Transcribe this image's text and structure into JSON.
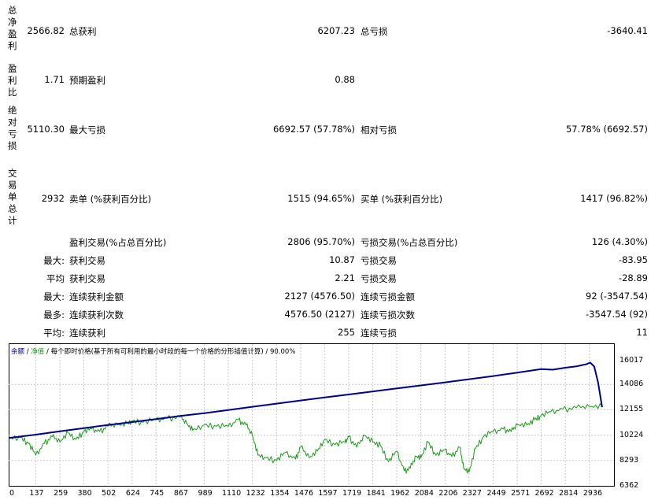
{
  "report": {
    "row1": {
      "vlabel": "总净盈利",
      "v1": "2566.82",
      "l2": "总获利",
      "v2": "6207.23",
      "l3": "总亏损",
      "v3": "-3640.41"
    },
    "row2": {
      "vlabel": "盈利比",
      "v1": "1.71",
      "l2": "预期盈利",
      "v2": "0.88"
    },
    "row3": {
      "vlabel": "绝对亏损",
      "v1": "5110.30",
      "l2": "最大亏损",
      "v2": "6692.57 (57.78%)",
      "l3": "相对亏损",
      "v3": "57.78% (6692.57)"
    },
    "row4": {
      "vlabel": "交易单总计",
      "v1": "2932",
      "l2": "卖单 (%获利百分比)",
      "v2": "1515 (94.65%)",
      "l3": "买单 (%获利百分比)",
      "v3": "1417 (96.82%)"
    },
    "stats": [
      {
        "prefix": "",
        "l2": "盈利交易(%占总百分比)",
        "v2": "2806 (95.70%)",
        "l3": "亏损交易(%占总百分比)",
        "v3": "126 (4.30%)"
      },
      {
        "prefix": "最大:",
        "l2": "获利交易",
        "v2": "10.87",
        "l3": "亏损交易",
        "v3": "-83.95"
      },
      {
        "prefix": "平均",
        "l2": "获利交易",
        "v2": "2.21",
        "l3": "亏损交易",
        "v3": "-28.89"
      },
      {
        "prefix": "最大:",
        "l2": "连续获利金额",
        "v2": "2127 (4576.50)",
        "l3": "连续亏损金额",
        "v3": "92 (-3547.54)"
      },
      {
        "prefix": "最多:",
        "l2": "连续获利次数",
        "v2": "4576.50 (2127)",
        "l3": "连续亏损次数",
        "v3": "-3547.54 (92)"
      },
      {
        "prefix": "平均:",
        "l2": "连续获利",
        "v2": "255",
        "l3": "连续亏损",
        "v3": "11"
      }
    ]
  },
  "chart_legend": {
    "balance": "余额",
    "sep1": " / ",
    "equity": "净值",
    "rest": " / 每个即时价格(基于所有可利用的最小时段的每一个价格的分形插值计算) / 90.00%"
  },
  "colors": {
    "balance": "#00008b",
    "equity": "#1a9a1a",
    "grid": "#c8c8c8"
  },
  "chart_data": {
    "type": "line",
    "title": "",
    "xlabel": "",
    "ylabel": "",
    "x_ticks": [
      "0",
      "137",
      "259",
      "380",
      "502",
      "624",
      "745",
      "867",
      "989",
      "1110",
      "1232",
      "1354",
      "1476",
      "1597",
      "1719",
      "1841",
      "1962",
      "2084",
      "2206",
      "2327",
      "2449",
      "2571",
      "2692",
      "2814",
      "2936"
    ],
    "y_ticks": [
      "16017",
      "14086",
      "12155",
      "10224",
      "8293",
      "6362"
    ],
    "ylim": [
      6362,
      16017
    ],
    "xlim": [
      0,
      3060
    ],
    "grid": true,
    "series": [
      {
        "name": "余额",
        "x": [
          0,
          137,
          259,
          380,
          502,
          624,
          745,
          867,
          989,
          1110,
          1232,
          1354,
          1476,
          1597,
          1719,
          1841,
          1962,
          2084,
          2206,
          2327,
          2449,
          2571,
          2692,
          2750,
          2814,
          2870,
          2900,
          2920,
          2940,
          2960,
          2980,
          3000
        ],
        "values": [
          10000,
          10260,
          10520,
          10760,
          11000,
          11220,
          11450,
          11680,
          11900,
          12130,
          12380,
          12620,
          12860,
          13090,
          13320,
          13550,
          13780,
          14010,
          14240,
          14480,
          14720,
          14980,
          15250,
          15210,
          15360,
          15460,
          15560,
          15620,
          15750,
          15450,
          14200,
          12350
        ]
      },
      {
        "name": "净值",
        "x": [
          0,
          60,
          100,
          137,
          180,
          220,
          259,
          300,
          340,
          380,
          420,
          460,
          502,
          550,
          600,
          624,
          680,
          745,
          800,
          867,
          900,
          930,
          989,
          1050,
          1110,
          1160,
          1200,
          1232,
          1260,
          1300,
          1354,
          1400,
          1450,
          1476,
          1520,
          1560,
          1597,
          1650,
          1700,
          1719,
          1760,
          1800,
          1841,
          1880,
          1920,
          1962,
          2000,
          2030,
          2060,
          2084,
          2120,
          2160,
          2206,
          2240,
          2280,
          2300,
          2327,
          2360,
          2400,
          2449,
          2500,
          2540,
          2571,
          2620,
          2660,
          2692,
          2740,
          2800,
          2870,
          2936,
          3000
        ],
        "values": [
          10000,
          10050,
          9600,
          8700,
          9600,
          10100,
          9700,
          10400,
          9900,
          10500,
          10700,
          10500,
          10900,
          11000,
          11100,
          11300,
          11200,
          11400,
          11500,
          11600,
          11100,
          10600,
          11000,
          10900,
          10900,
          11400,
          11000,
          10200,
          8700,
          8500,
          8300,
          8900,
          8400,
          9300,
          8500,
          9000,
          9900,
          9500,
          9700,
          10100,
          9300,
          10200,
          9700,
          9400,
          8200,
          9000,
          7500,
          7700,
          8600,
          8500,
          9700,
          8700,
          9100,
          8600,
          9300,
          7700,
          7400,
          9200,
          10100,
          10500,
          10700,
          10500,
          11000,
          11000,
          11400,
          11700,
          12000,
          12200,
          12300,
          12400,
          12400
        ]
      }
    ]
  }
}
